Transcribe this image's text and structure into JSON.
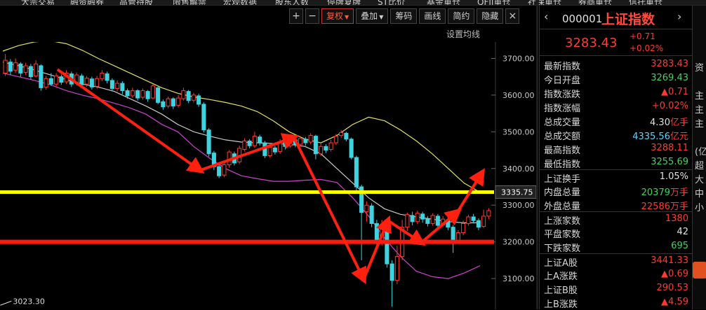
{
  "topnav": {
    "items": [
      "大宗交易",
      "融资融券",
      "高管持股",
      "限售解禁",
      "宏观数据",
      "股东人数",
      "停牌复牌",
      "ST比价",
      "基金重仓",
      "QFII重仓",
      "社保重仓",
      "券商重仓",
      "信托重仓"
    ]
  },
  "toolbar": {
    "plus": "+",
    "minus": "−",
    "adjust": "复权",
    "overlay": "叠加",
    "chips": "筹码",
    "draw": "画线",
    "brief": "简约",
    "hide": "隐藏",
    "close": "×"
  },
  "chart": {
    "setting_label": "设置均线",
    "low_label": "3023.30",
    "ylabels": [
      "3700.00",
      "3600.00",
      "3500.00",
      "3400.00",
      "3335.75",
      "3300.00",
      "3200.00",
      "3100.00"
    ],
    "current_price_label": "3335.75"
  },
  "chart_data": {
    "type": "candlestick",
    "ylim": [
      3020,
      3760
    ],
    "y_ticks": [
      3100,
      3200,
      3300,
      3400,
      3500,
      3600,
      3700
    ],
    "support_line": 3200,
    "resistance_line": 3335.75,
    "low_marker": 3023.3,
    "candles": [
      {
        "o": 3660,
        "c": 3695,
        "h": 3712,
        "l": 3652
      },
      {
        "o": 3690,
        "c": 3665,
        "h": 3698,
        "l": 3655
      },
      {
        "o": 3668,
        "c": 3688,
        "h": 3700,
        "l": 3660
      },
      {
        "o": 3685,
        "c": 3660,
        "h": 3690,
        "l": 3650
      },
      {
        "o": 3662,
        "c": 3680,
        "h": 3688,
        "l": 3655
      },
      {
        "o": 3678,
        "c": 3650,
        "h": 3685,
        "l": 3642
      },
      {
        "o": 3652,
        "c": 3685,
        "h": 3695,
        "l": 3648
      },
      {
        "o": 3680,
        "c": 3620,
        "h": 3684,
        "l": 3612
      },
      {
        "o": 3622,
        "c": 3645,
        "h": 3652,
        "l": 3615
      },
      {
        "o": 3645,
        "c": 3630,
        "h": 3660,
        "l": 3625
      },
      {
        "o": 3630,
        "c": 3652,
        "h": 3660,
        "l": 3624
      },
      {
        "o": 3650,
        "c": 3635,
        "h": 3656,
        "l": 3628
      },
      {
        "o": 3636,
        "c": 3660,
        "h": 3668,
        "l": 3630
      },
      {
        "o": 3658,
        "c": 3630,
        "h": 3664,
        "l": 3622
      },
      {
        "o": 3632,
        "c": 3655,
        "h": 3662,
        "l": 3626
      },
      {
        "o": 3652,
        "c": 3628,
        "h": 3658,
        "l": 3620
      },
      {
        "o": 3630,
        "c": 3646,
        "h": 3652,
        "l": 3622
      },
      {
        "o": 3644,
        "c": 3622,
        "h": 3650,
        "l": 3615
      },
      {
        "o": 3624,
        "c": 3645,
        "h": 3652,
        "l": 3618
      },
      {
        "o": 3645,
        "c": 3660,
        "h": 3668,
        "l": 3638
      },
      {
        "o": 3658,
        "c": 3640,
        "h": 3664,
        "l": 3632
      },
      {
        "o": 3640,
        "c": 3618,
        "h": 3646,
        "l": 3610
      },
      {
        "o": 3618,
        "c": 3632,
        "h": 3640,
        "l": 3610
      },
      {
        "o": 3632,
        "c": 3612,
        "h": 3638,
        "l": 3602
      },
      {
        "o": 3612,
        "c": 3598,
        "h": 3618,
        "l": 3590
      },
      {
        "o": 3598,
        "c": 3612,
        "h": 3620,
        "l": 3592
      },
      {
        "o": 3612,
        "c": 3592,
        "h": 3616,
        "l": 3585
      },
      {
        "o": 3594,
        "c": 3612,
        "h": 3618,
        "l": 3588
      },
      {
        "o": 3610,
        "c": 3590,
        "h": 3614,
        "l": 3582
      },
      {
        "o": 3592,
        "c": 3625,
        "h": 3630,
        "l": 3588
      },
      {
        "o": 3620,
        "c": 3580,
        "h": 3626,
        "l": 3575
      },
      {
        "o": 3582,
        "c": 3568,
        "h": 3588,
        "l": 3560
      },
      {
        "o": 3570,
        "c": 3590,
        "h": 3596,
        "l": 3564
      },
      {
        "o": 3590,
        "c": 3570,
        "h": 3594,
        "l": 3562
      },
      {
        "o": 3572,
        "c": 3592,
        "h": 3600,
        "l": 3566
      },
      {
        "o": 3590,
        "c": 3612,
        "h": 3620,
        "l": 3585
      },
      {
        "o": 3610,
        "c": 3585,
        "h": 3614,
        "l": 3578
      },
      {
        "o": 3586,
        "c": 3600,
        "h": 3606,
        "l": 3580
      },
      {
        "o": 3598,
        "c": 3575,
        "h": 3604,
        "l": 3568
      },
      {
        "o": 3575,
        "c": 3505,
        "h": 3580,
        "l": 3498
      },
      {
        "o": 3505,
        "c": 3440,
        "h": 3510,
        "l": 3432
      },
      {
        "o": 3442,
        "c": 3405,
        "h": 3448,
        "l": 3396
      },
      {
        "o": 3405,
        "c": 3380,
        "h": 3412,
        "l": 3374
      },
      {
        "o": 3382,
        "c": 3410,
        "h": 3418,
        "l": 3376
      },
      {
        "o": 3410,
        "c": 3445,
        "h": 3450,
        "l": 3402
      },
      {
        "o": 3440,
        "c": 3415,
        "h": 3446,
        "l": 3408
      },
      {
        "o": 3418,
        "c": 3455,
        "h": 3462,
        "l": 3412
      },
      {
        "o": 3452,
        "c": 3475,
        "h": 3482,
        "l": 3446
      },
      {
        "o": 3475,
        "c": 3462,
        "h": 3480,
        "l": 3455
      },
      {
        "o": 3462,
        "c": 3488,
        "h": 3500,
        "l": 3456
      },
      {
        "o": 3486,
        "c": 3470,
        "h": 3492,
        "l": 3462
      },
      {
        "o": 3470,
        "c": 3435,
        "h": 3475,
        "l": 3428
      },
      {
        "o": 3435,
        "c": 3458,
        "h": 3465,
        "l": 3430
      },
      {
        "o": 3456,
        "c": 3445,
        "h": 3462,
        "l": 3438
      },
      {
        "o": 3446,
        "c": 3472,
        "h": 3480,
        "l": 3440
      },
      {
        "o": 3470,
        "c": 3460,
        "h": 3476,
        "l": 3452
      },
      {
        "o": 3462,
        "c": 3480,
        "h": 3488,
        "l": 3456
      },
      {
        "o": 3478,
        "c": 3465,
        "h": 3484,
        "l": 3458
      },
      {
        "o": 3466,
        "c": 3482,
        "h": 3488,
        "l": 3460
      },
      {
        "o": 3480,
        "c": 3470,
        "h": 3486,
        "l": 3462
      },
      {
        "o": 3472,
        "c": 3490,
        "h": 3496,
        "l": 3466
      },
      {
        "o": 3488,
        "c": 3440,
        "h": 3492,
        "l": 3425
      },
      {
        "o": 3440,
        "c": 3460,
        "h": 3468,
        "l": 3434
      },
      {
        "o": 3460,
        "c": 3450,
        "h": 3466,
        "l": 3442
      },
      {
        "o": 3452,
        "c": 3470,
        "h": 3478,
        "l": 3446
      },
      {
        "o": 3470,
        "c": 3488,
        "h": 3494,
        "l": 3464
      },
      {
        "o": 3490,
        "c": 3498,
        "h": 3505,
        "l": 3484
      },
      {
        "o": 3496,
        "c": 3480,
        "h": 3500,
        "l": 3474
      },
      {
        "o": 3480,
        "c": 3430,
        "h": 3484,
        "l": 3425
      },
      {
        "o": 3430,
        "c": 3350,
        "h": 3435,
        "l": 3340
      },
      {
        "o": 3350,
        "c": 3280,
        "h": 3356,
        "l": 3150
      },
      {
        "o": 3282,
        "c": 3300,
        "h": 3310,
        "l": 3255
      },
      {
        "o": 3298,
        "c": 3250,
        "h": 3305,
        "l": 3240
      },
      {
        "o": 3250,
        "c": 3200,
        "h": 3260,
        "l": 3180
      },
      {
        "o": 3200,
        "c": 3240,
        "h": 3260,
        "l": 3190
      },
      {
        "o": 3238,
        "c": 3140,
        "h": 3245,
        "l": 3130
      },
      {
        "o": 3140,
        "c": 3095,
        "h": 3150,
        "l": 3023
      },
      {
        "o": 3095,
        "c": 3160,
        "h": 3190,
        "l": 3085
      },
      {
        "o": 3160,
        "c": 3240,
        "h": 3260,
        "l": 3150
      },
      {
        "o": 3240,
        "c": 3275,
        "h": 3280,
        "l": 3230
      },
      {
        "o": 3272,
        "c": 3255,
        "h": 3282,
        "l": 3245
      },
      {
        "o": 3255,
        "c": 3278,
        "h": 3285,
        "l": 3248
      },
      {
        "o": 3276,
        "c": 3262,
        "h": 3282,
        "l": 3252
      },
      {
        "o": 3262,
        "c": 3250,
        "h": 3270,
        "l": 3242
      },
      {
        "o": 3250,
        "c": 3272,
        "h": 3278,
        "l": 3244
      },
      {
        "o": 3270,
        "c": 3245,
        "h": 3276,
        "l": 3238
      },
      {
        "o": 3246,
        "c": 3262,
        "h": 3270,
        "l": 3240
      },
      {
        "o": 3260,
        "c": 3240,
        "h": 3266,
        "l": 3232
      },
      {
        "o": 3240,
        "c": 3200,
        "h": 3246,
        "l": 3170
      },
      {
        "o": 3202,
        "c": 3225,
        "h": 3232,
        "l": 3196
      },
      {
        "o": 3225,
        "c": 3250,
        "h": 3258,
        "l": 3218
      },
      {
        "o": 3250,
        "c": 3268,
        "h": 3274,
        "l": 3244
      },
      {
        "o": 3268,
        "c": 3258,
        "h": 3276,
        "l": 3250
      },
      {
        "o": 3258,
        "c": 3240,
        "h": 3264,
        "l": 3232
      },
      {
        "o": 3242,
        "c": 3270,
        "h": 3288,
        "l": 3238
      },
      {
        "o": 3270,
        "c": 3285,
        "h": 3292,
        "l": 3262
      }
    ],
    "ma_series": [
      {
        "name": "",
        "color": "#e0e060",
        "values": [
          3720,
          3735,
          3745,
          3748,
          3740,
          3722,
          3700,
          3680,
          3660,
          3640,
          3620,
          3605,
          3595,
          3588,
          3580,
          3570,
          3555,
          3530,
          3500,
          3480,
          3470,
          3490,
          3520,
          3540,
          3530,
          3505,
          3475,
          3440,
          3400,
          3360,
          3335
        ]
      },
      {
        "name": "",
        "color": "#c8c8c8",
        "values": [
          3690,
          3680,
          3668,
          3655,
          3642,
          3630,
          3622,
          3610,
          3590,
          3570,
          3548,
          3520,
          3500,
          3488,
          3478,
          3472,
          3470,
          3468,
          3466,
          3460,
          3440,
          3400,
          3360,
          3320,
          3290,
          3275,
          3268,
          3262,
          3255,
          3252,
          3252
        ]
      },
      {
        "name": "",
        "color": "#d040d0",
        "values": [
          3660,
          3650,
          3640,
          3628,
          3612,
          3600,
          3590,
          3578,
          3565,
          3548,
          3520,
          3500,
          3460,
          3428,
          3400,
          3380,
          3372,
          3365,
          3365,
          3368,
          3370,
          3362,
          3320,
          3270,
          3210,
          3160,
          3120,
          3105,
          3100,
          3115,
          3135
        ]
      }
    ],
    "arrows": [
      {
        "from": [
          18,
          3670
        ],
        "to": [
          65,
          3395
        ]
      },
      {
        "from": [
          65,
          3395
        ],
        "to": [
          96,
          3485
        ]
      },
      {
        "from": [
          96,
          3485
        ],
        "to": [
          119,
          3098
        ]
      },
      {
        "from": [
          119,
          3098
        ],
        "to": [
          127,
          3258
        ]
      },
      {
        "from": [
          127,
          3258
        ],
        "to": [
          138,
          3198
        ]
      },
      {
        "from": [
          138,
          3198
        ],
        "to": [
          150,
          3282
        ]
      },
      {
        "from": [
          150,
          3282
        ],
        "to": [
          158,
          3388
        ]
      }
    ]
  },
  "sidebar": {
    "prev": "‹",
    "code": "000001",
    "name": "上证指数",
    "next": "›",
    "price": "3283.43",
    "chg": "+0.71",
    "chg_pct": "+0.02%",
    "rows": [
      {
        "label": "最新指数",
        "value": "3283.43",
        "color": "red",
        "sep": false
      },
      {
        "label": "今日开盘",
        "value": "3269.43",
        "color": "green",
        "sep": false
      },
      {
        "label": "指数涨跌",
        "value": "▲0.71",
        "color": "red",
        "sep": false
      },
      {
        "label": "指数涨幅",
        "value": "+0.02%",
        "color": "red",
        "sep": false
      },
      {
        "label": "总成交量",
        "value": "4.30",
        "unit": "亿手",
        "color": "white",
        "sep": false
      },
      {
        "label": "总成交额",
        "value": "4335.56",
        "unit": "亿元",
        "color": "cyan",
        "sep": false
      },
      {
        "label": "最高指数",
        "value": "3288.11",
        "color": "red",
        "sep": false
      },
      {
        "label": "最低指数",
        "value": "3255.69",
        "color": "green",
        "sep": false
      },
      {
        "label": "上证换手",
        "value": "1.05%",
        "color": "white",
        "sep": true
      },
      {
        "label": "内盘总量",
        "value": "20379",
        "unit": "万手",
        "color": "green",
        "sep": false
      },
      {
        "label": "外盘总量",
        "value": "22586",
        "unit": "万手",
        "color": "red",
        "sep": false
      },
      {
        "label": "上涨家数",
        "value": "1380",
        "color": "red",
        "sep": true
      },
      {
        "label": "平盘家数",
        "value": "42",
        "color": "white",
        "sep": false
      },
      {
        "label": "下跌家数",
        "value": "695",
        "color": "green",
        "sep": false
      },
      {
        "label": "上证A股",
        "value": "3441.33",
        "color": "red",
        "sep": true
      },
      {
        "label": "上A涨跌",
        "value": "▲0.69",
        "color": "red",
        "sep": false
      },
      {
        "label": "上证B股",
        "value": "290.53",
        "color": "red",
        "sep": false
      },
      {
        "label": "上B涨跌",
        "value": "▲4.59",
        "color": "red",
        "sep": false
      }
    ]
  },
  "rightcut": {
    "items": [
      "资",
      "主",
      "主",
      "主",
      "(亿",
      "超",
      "大",
      "中",
      "小"
    ]
  },
  "colors": {
    "up": "#ff3a30",
    "down": "#3fd3e0",
    "support": "#ff1a10",
    "resistance": "#ffff00",
    "arrow": "#ff2010"
  }
}
